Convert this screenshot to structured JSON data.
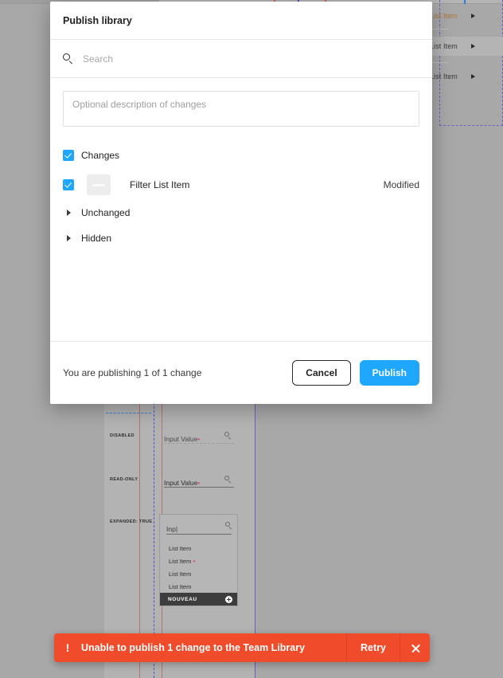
{
  "dialog": {
    "title": "Publish library",
    "search": {
      "placeholder": "Search",
      "value": "",
      "icon": "search-icon"
    },
    "description": {
      "placeholder": "Optional description of changes",
      "value": ""
    },
    "sections": [
      {
        "label": "Changes",
        "checked": true
      },
      {
        "label": "Unchanged",
        "expanded": false
      },
      {
        "label": "Hidden",
        "expanded": false
      }
    ],
    "items": [
      {
        "name": "Filter List Item",
        "status": "Modified",
        "checked": true
      }
    ],
    "footer": {
      "status": "You are publishing 1 of 1 change",
      "cancel_label": "Cancel",
      "publish_label": "Publish"
    }
  },
  "toast": {
    "icon": "!",
    "message": "Unable to publish 1 change to the Team Library",
    "retry_label": "Retry",
    "close_icon": "close-icon",
    "color": "#f04b2a"
  },
  "canvas": {
    "right_panel": {
      "rows": [
        {
          "label": "List Item",
          "selected": false
        },
        {
          "label": "List Item",
          "selected": true
        },
        {
          "label": "List Item",
          "selected": false
        }
      ]
    },
    "fields": [
      {
        "label": "DISABLED",
        "value": "Input Value",
        "required_mark": "•"
      },
      {
        "label": "READ-ONLY",
        "value": "Input Value",
        "required_mark": "•"
      },
      {
        "label": "EXPANDED: TRUE",
        "value": "",
        "required_mark": ""
      }
    ],
    "dropdown": {
      "search_value": "Inp|",
      "items": [
        {
          "label": "List Item",
          "mark": ""
        },
        {
          "label": "List Item",
          "mark": "•"
        },
        {
          "label": "List Item",
          "mark": ""
        },
        {
          "label": "List Item",
          "mark": ""
        }
      ],
      "footer_label": "NOUVEAU",
      "footer_icon": "plus-circle-icon"
    }
  },
  "colors": {
    "accent_blue": "#1ea7fd",
    "error_red": "#f04b2a",
    "canvas_gray": "#a8a8a8",
    "guide_purple": "#6f5fc4",
    "guide_red": "#bd7070",
    "guide_blue": "#2f7fe0"
  }
}
